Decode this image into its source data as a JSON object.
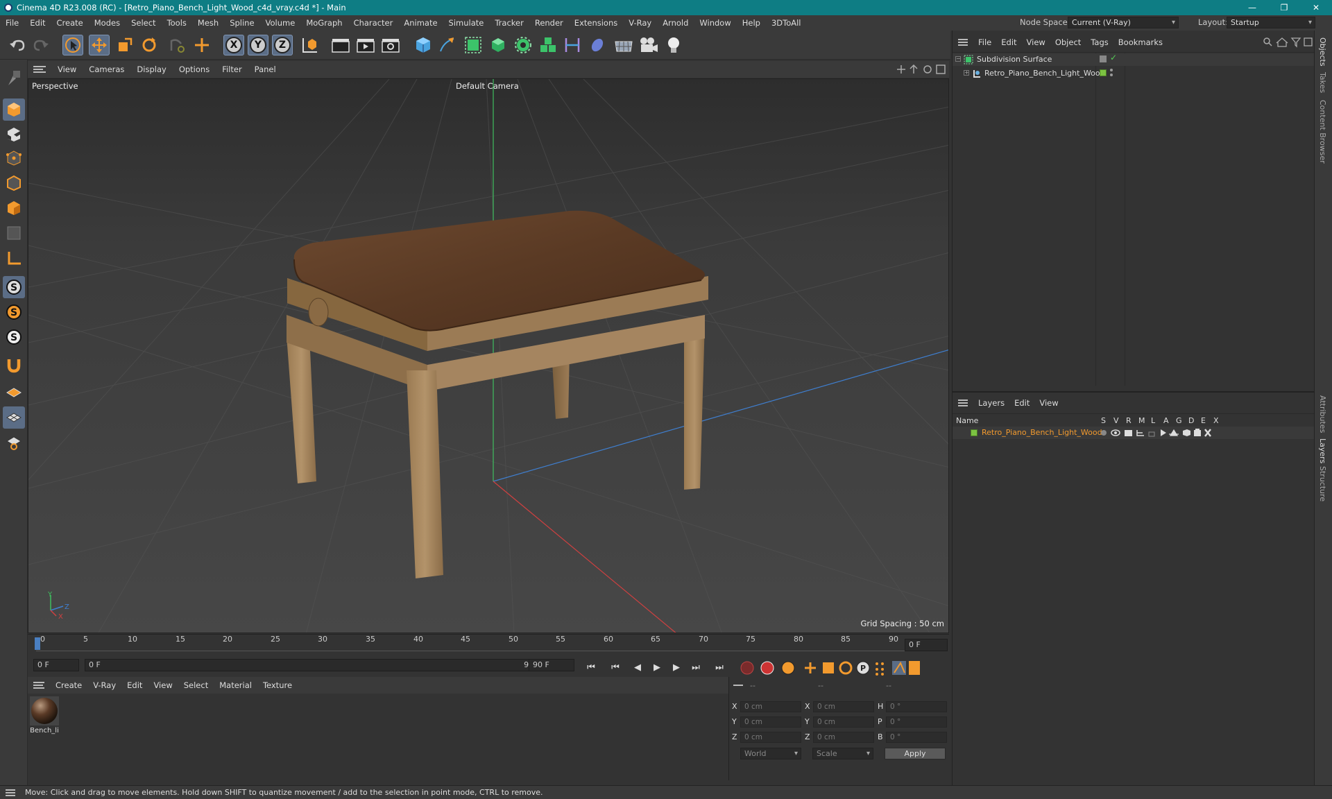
{
  "window": {
    "title": "Cinema 4D R23.008 (RC) - [Retro_Piano_Bench_Light_Wood_c4d_vray.c4d *] - Main",
    "controls": {
      "minimize": "—",
      "maximize": "❐",
      "close": "✕"
    }
  },
  "menubar": {
    "items": [
      "File",
      "Edit",
      "Create",
      "Modes",
      "Select",
      "Tools",
      "Mesh",
      "Spline",
      "Volume",
      "MoGraph",
      "Character",
      "Animate",
      "Simulate",
      "Tracker",
      "Render",
      "Extensions",
      "V-Ray",
      "Arnold",
      "Window",
      "Help",
      "3DToAll"
    ],
    "node_space_label": "Node Space:",
    "node_space_value": "Current (V-Ray)",
    "layout_label": "Layout:",
    "layout_value": "Startup"
  },
  "viewport": {
    "menu": [
      "View",
      "Cameras",
      "Display",
      "Options",
      "Filter",
      "Panel"
    ],
    "label": "Perspective",
    "camera": "Default Camera",
    "grid_spacing": "Grid Spacing : 50 cm",
    "axis_y": "Y",
    "axis_z": "Z",
    "axis_x": "X"
  },
  "timeline": {
    "ticks": [
      "0",
      "5",
      "10",
      "15",
      "20",
      "25",
      "30",
      "35",
      "40",
      "45",
      "50",
      "55",
      "60",
      "65",
      "70",
      "75",
      "80",
      "85",
      "90"
    ],
    "current_frame": "0 F"
  },
  "transport": {
    "start": "0 F",
    "range_start": "0 F",
    "range_end": "90 F",
    "end": "90 F"
  },
  "material_manager": {
    "menu": [
      "Create",
      "V-Ray",
      "Edit",
      "View",
      "Select",
      "Material",
      "Texture"
    ],
    "material_name": "Bench_li"
  },
  "coordinates": {
    "header": [
      "--",
      "--",
      "--"
    ],
    "rows": [
      {
        "a": "X",
        "v1": "0 cm",
        "b": "X",
        "v2": "0 cm",
        "c": "H",
        "v3": "0 °"
      },
      {
        "a": "Y",
        "v1": "0 cm",
        "b": "Y",
        "v2": "0 cm",
        "c": "P",
        "v3": "0 °"
      },
      {
        "a": "Z",
        "v1": "0 cm",
        "b": "Z",
        "v2": "0 cm",
        "c": "B",
        "v3": "0 °"
      }
    ],
    "world": "World",
    "scale": "Scale",
    "apply": "Apply"
  },
  "object_manager": {
    "menu": [
      "File",
      "Edit",
      "View",
      "Object",
      "Tags",
      "Bookmarks"
    ],
    "objects": [
      "Subdivision Surface",
      "Retro_Piano_Bench_Light_Wood"
    ]
  },
  "layer_manager": {
    "menu": [
      "Layers",
      "Edit",
      "View"
    ],
    "columns": [
      "Name",
      "S",
      "V",
      "R",
      "M",
      "L",
      "A",
      "G",
      "D",
      "E",
      "X"
    ],
    "layer": "Retro_Piano_Bench_Light_Wood",
    "layer_color": "#7cc242"
  },
  "side_tabs": [
    "Objects",
    "Takes",
    "Content Browser",
    "Attributes",
    "Layers",
    "Structure"
  ],
  "status": "Move: Click and drag to move elements. Hold down SHIFT to quantize movement / add to the selection in point mode, CTRL to remove.",
  "colors": {
    "titlebar": "#0e7d84",
    "accent_orange": "#f29a2e",
    "selection_blue": "#5b6d86"
  }
}
